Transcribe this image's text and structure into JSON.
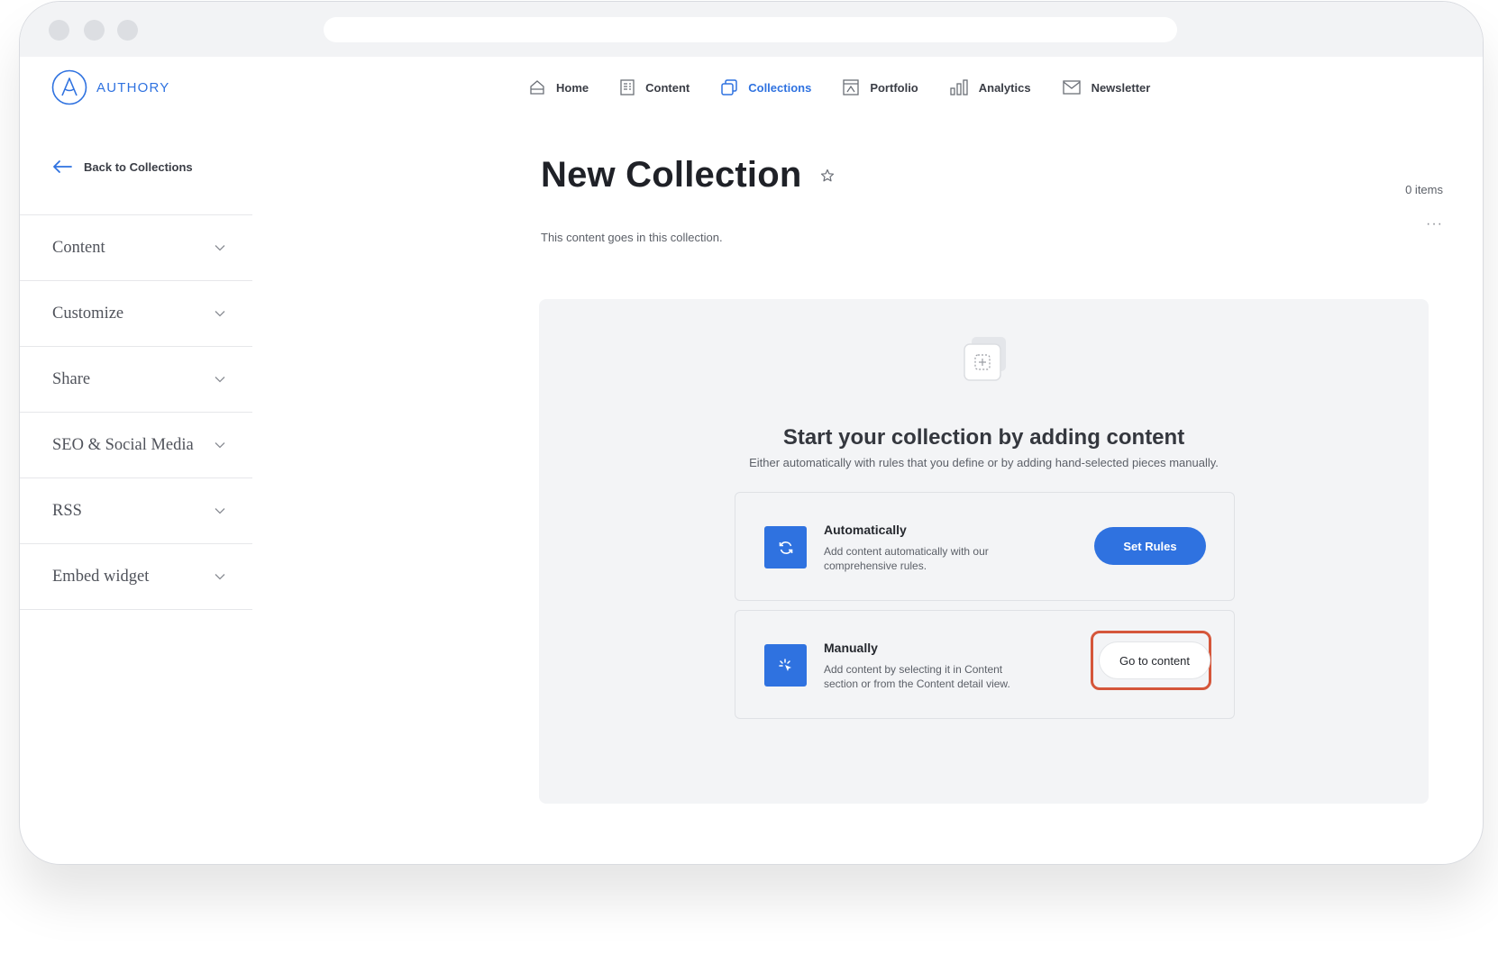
{
  "brand": {
    "name": "AUTHORY",
    "color": "#2f72e0"
  },
  "nav": [
    {
      "label": "Home",
      "icon": "home-icon",
      "active": false
    },
    {
      "label": "Content",
      "icon": "document-icon",
      "active": false
    },
    {
      "label": "Collections",
      "icon": "collections-icon",
      "active": true
    },
    {
      "label": "Portfolio",
      "icon": "portfolio-icon",
      "active": false
    },
    {
      "label": "Analytics",
      "icon": "bar-chart-icon",
      "active": false
    },
    {
      "label": "Newsletter",
      "icon": "envelope-icon",
      "active": false
    }
  ],
  "back_link": {
    "label": "Back to Collections"
  },
  "sidebar": {
    "items": [
      {
        "label": "Content"
      },
      {
        "label": "Customize"
      },
      {
        "label": "Share"
      },
      {
        "label": "SEO & Social Media"
      },
      {
        "label": "RSS"
      },
      {
        "label": "Embed widget"
      }
    ]
  },
  "collection": {
    "title": "New Collection",
    "description": "This content goes in this collection.",
    "items_count": "0 items",
    "more_label": "···"
  },
  "empty_state": {
    "heading": "Start your collection by adding content",
    "subheading": "Either automatically with rules that you define or by adding hand-selected pieces manually.",
    "options": {
      "automatic": {
        "title": "Automatically",
        "description": "Add content automatically with our comprehensive rules.",
        "button": "Set Rules",
        "icon": "refresh-icon"
      },
      "manual": {
        "title": "Manually",
        "description": "Add content by selecting it in Content section or from the Content detail view.",
        "button": "Go to content",
        "icon": "cursor-click-icon"
      }
    }
  },
  "colors": {
    "accent": "#2f72e0",
    "highlight": "#d5563a",
    "panel": "#f3f4f6"
  }
}
